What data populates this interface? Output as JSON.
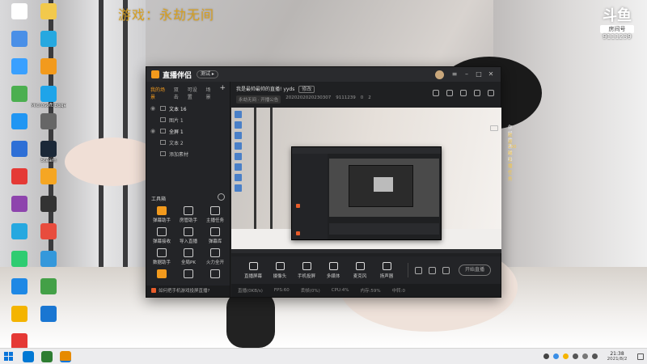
{
  "overlay": {
    "game_text": "游戏：永劫无间"
  },
  "watermark": {
    "brand": "斗鱼",
    "room_label": "房间号",
    "room_id": "9111239"
  },
  "desktop_icons": [
    {
      "label": "",
      "color": "#ffffff"
    },
    {
      "label": "",
      "color": "#f2c94c"
    },
    {
      "label": "",
      "color": "#4a8fe7"
    },
    {
      "label": "",
      "color": "#26a8e0"
    },
    {
      "label": "",
      "color": "#3aa0ff"
    },
    {
      "label": "",
      "color": "#f29a1d"
    },
    {
      "label": "",
      "color": "#4caf50"
    },
    {
      "label": "Microsoft Edge",
      "color": "#1ea4e9"
    },
    {
      "label": "",
      "color": "#2196f3"
    },
    {
      "label": "",
      "color": "#666666"
    },
    {
      "label": "",
      "color": "#2e6fd6"
    },
    {
      "label": "Steam",
      "color": "#1b2838"
    },
    {
      "label": "",
      "color": "#e53935"
    },
    {
      "label": "",
      "color": "#f5a623"
    },
    {
      "label": "",
      "color": "#8e44ad"
    },
    {
      "label": "",
      "color": "#333333"
    },
    {
      "label": "",
      "color": "#26a8e0"
    },
    {
      "label": "",
      "color": "#e84c3d"
    },
    {
      "label": "",
      "color": "#2ecc71"
    },
    {
      "label": "",
      "color": "#3498db"
    },
    {
      "label": "",
      "color": "#1e88e5"
    },
    {
      "label": "",
      "color": "#43a047"
    },
    {
      "label": "",
      "color": "#f4b400"
    },
    {
      "label": "",
      "color": "#1976d2"
    },
    {
      "label": "",
      "color": "#e53935"
    }
  ],
  "app": {
    "title": "直播伴侣",
    "badge": "测试 ▸",
    "scene_tabs": [
      "我的场景",
      "双击",
      "可设置",
      "场景"
    ],
    "sources": [
      {
        "label": "文本 16",
        "on": true
      },
      {
        "label": "图片 1",
        "on": false
      },
      {
        "label": "全屏 1",
        "on": true
      },
      {
        "label": "文本 2",
        "on": false
      },
      {
        "label": "添加素材",
        "on": false
      }
    ],
    "tools_title": "工具箱",
    "tools": [
      {
        "label": "弹幕助手",
        "orange": true
      },
      {
        "label": "房管助手",
        "orange": false
      },
      {
        "label": "主播任务",
        "orange": false
      },
      {
        "label": "弹幕接收",
        "orange": false
      },
      {
        "label": "导入直播",
        "orange": false
      },
      {
        "label": "弹幕库",
        "orange": false
      },
      {
        "label": "数据助手",
        "orange": false
      },
      {
        "label": "全局PK",
        "orange": false
      },
      {
        "label": "火力全开",
        "orange": false
      },
      {
        "label": "",
        "orange": true
      },
      {
        "label": "",
        "orange": false
      },
      {
        "label": "",
        "orange": false
      }
    ],
    "sidebar_foot": "如何把手机游戏投屏直播?",
    "stream": {
      "title": "我是最帅最帅的直播!",
      "title_suffix": "yyds",
      "tag": "修改",
      "meta": [
        "永劫无间 · 开播公告",
        "2020202020230307",
        "9111239",
        "0",
        "2"
      ]
    },
    "chat": [
      {
        "text": "你好的 游戏吗",
        "hl": false
      },
      {
        "text": "欢迎100级 主播任务",
        "hl": true
      }
    ],
    "controls": [
      {
        "label": "直播屏幕"
      },
      {
        "label": "摄像头"
      },
      {
        "label": "手机投屏"
      },
      {
        "label": "多媒体"
      },
      {
        "label": "麦克风"
      },
      {
        "label": "扬声器"
      }
    ],
    "start_button": "开始直播",
    "status": [
      "直播(0KB/s)",
      "FPS:60",
      "丢帧(0%)",
      "CPU:4%",
      "内存:59%",
      "中转:0"
    ]
  },
  "taskbar": {
    "clock_time": "21:38",
    "clock_date": "2021/8/2",
    "apps": [
      {
        "color": "#0078d4",
        "active": false
      },
      {
        "color": "#2e7d32",
        "active": false
      },
      {
        "color": "#e68a00",
        "active": true
      }
    ],
    "tray": [
      "#444444",
      "#3a8ee6",
      "#f5b400",
      "#555555",
      "#777777",
      "#555555"
    ]
  }
}
